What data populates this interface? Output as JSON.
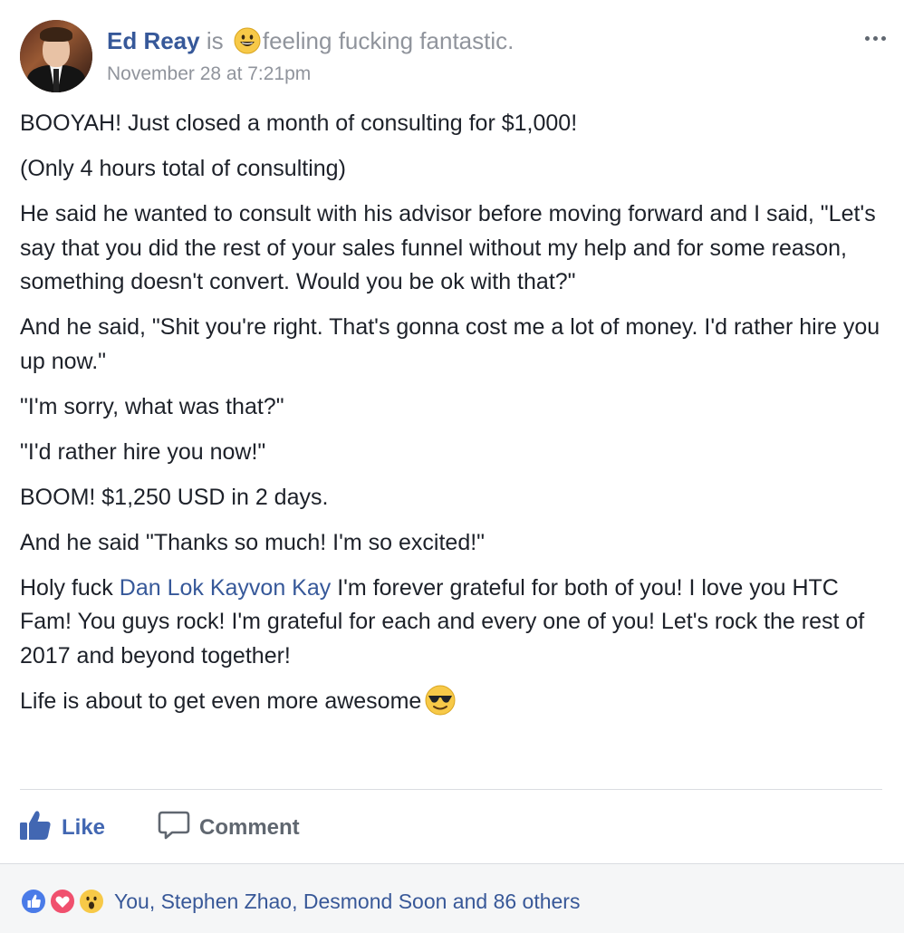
{
  "header": {
    "author_name": "Ed Reay",
    "is_text": "is",
    "feeling_text": "feeling fucking fantastic.",
    "feeling_icon": "grinning-face-icon",
    "timestamp": "November 28 at 7:21pm",
    "more_icon": "ellipsis-icon"
  },
  "post": {
    "paragraphs": [
      "BOOYAH! Just closed a month of consulting for $1,000!",
      "(Only 4 hours total of consulting)",
      "He said he wanted to consult with his advisor before moving forward and I said, \"Let's say that you did the rest of your sales funnel without my help and for some reason, something doesn't convert. Would you be ok with that?\"",
      "And he said, \"Shit you're right. That's gonna cost me a lot of money. I'd rather hire you up now.\"",
      "\"I'm sorry, what was that?\"",
      "\"I'd rather hire you now!\"",
      "BOOM! $1,250 USD in 2 days.",
      "And he said \"Thanks so much! I'm so excited!\""
    ],
    "mentions_paragraph": {
      "before": "Holy fuck ",
      "mention_1": "Dan Lok",
      "between": " ",
      "mention_2": "Kayvon Kay",
      "after": " I'm forever grateful for both of you! I love you HTC Fam! You guys rock! I'm grateful for each and every one of you! Let's rock the rest of 2017 and beyond together!"
    },
    "last_paragraph": "Life is about to get even more awesome",
    "last_emoji": "sunglasses-face-icon"
  },
  "actions": {
    "like_label": "Like",
    "comment_label": "Comment"
  },
  "reactions": {
    "icons": [
      "like-reaction-icon",
      "love-reaction-icon",
      "wow-reaction-icon"
    ],
    "summary": "You, Stephen Zhao, Desmond Soon and 86 others"
  },
  "colors": {
    "link_blue": "#365899",
    "like_blue": "#4267b2",
    "muted_gray": "#90949c",
    "text": "#1d2129"
  }
}
